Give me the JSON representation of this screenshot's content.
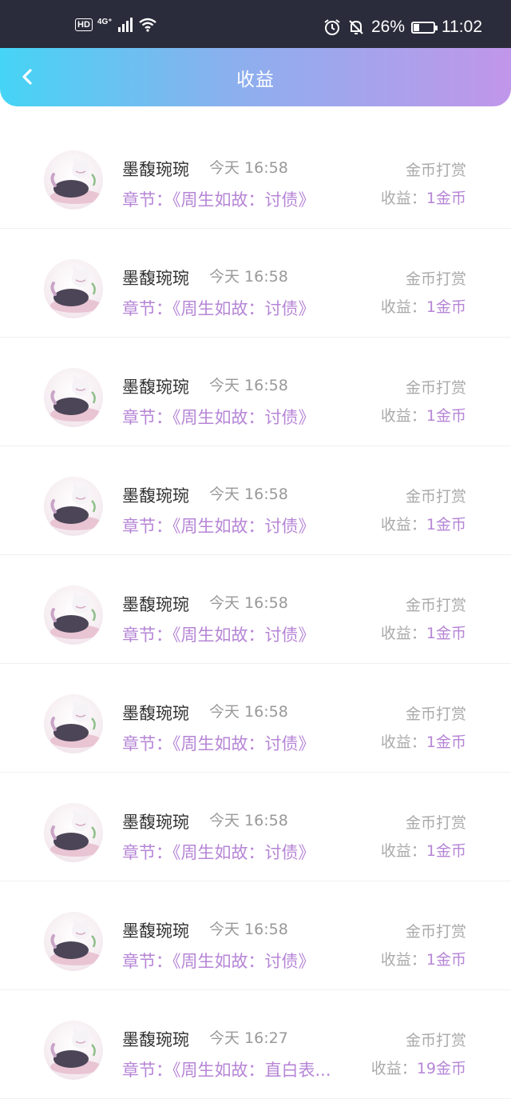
{
  "status_bar": {
    "hd": "HD",
    "network": "4G⁺",
    "battery": "26%",
    "battery_level": 0.26,
    "time": "11:02",
    "icons": [
      "hd-icon",
      "signal-icon",
      "wifi-icon",
      "alarm-icon",
      "mute-icon",
      "battery-icon"
    ]
  },
  "header": {
    "title": "收益",
    "back_icon": "chevron-left-icon",
    "gradient": [
      "#45d4f5",
      "#c196ea"
    ]
  },
  "colors": {
    "accent": "#b685d6",
    "muted": "#aaaaaa",
    "name": "#333333"
  },
  "records": [
    {
      "name": "墨馥琬琬",
      "time": "今天 16:58",
      "type": "金币打赏",
      "chapter_label": "章节：",
      "chapter": "《周生如故：讨债》",
      "earn_label": "收益：",
      "earn_value": "1金币"
    },
    {
      "name": "墨馥琬琬",
      "time": "今天 16:58",
      "type": "金币打赏",
      "chapter_label": "章节：",
      "chapter": "《周生如故：讨债》",
      "earn_label": "收益：",
      "earn_value": "1金币"
    },
    {
      "name": "墨馥琬琬",
      "time": "今天 16:58",
      "type": "金币打赏",
      "chapter_label": "章节：",
      "chapter": "《周生如故：讨债》",
      "earn_label": "收益：",
      "earn_value": "1金币"
    },
    {
      "name": "墨馥琬琬",
      "time": "今天 16:58",
      "type": "金币打赏",
      "chapter_label": "章节：",
      "chapter": "《周生如故：讨债》",
      "earn_label": "收益：",
      "earn_value": "1金币"
    },
    {
      "name": "墨馥琬琬",
      "time": "今天 16:58",
      "type": "金币打赏",
      "chapter_label": "章节：",
      "chapter": "《周生如故：讨债》",
      "earn_label": "收益：",
      "earn_value": "1金币"
    },
    {
      "name": "墨馥琬琬",
      "time": "今天 16:58",
      "type": "金币打赏",
      "chapter_label": "章节：",
      "chapter": "《周生如故：讨债》",
      "earn_label": "收益：",
      "earn_value": "1金币"
    },
    {
      "name": "墨馥琬琬",
      "time": "今天 16:58",
      "type": "金币打赏",
      "chapter_label": "章节：",
      "chapter": "《周生如故：讨债》",
      "earn_label": "收益：",
      "earn_value": "1金币"
    },
    {
      "name": "墨馥琬琬",
      "time": "今天 16:58",
      "type": "金币打赏",
      "chapter_label": "章节：",
      "chapter": "《周生如故：讨债》",
      "earn_label": "收益：",
      "earn_value": "1金币"
    },
    {
      "name": "墨馥琬琬",
      "time": "今天 16:27",
      "type": "金币打赏",
      "chapter_label": "章节：",
      "chapter": "《周生如故：直白表...",
      "earn_label": "收益：",
      "earn_value": "19金币"
    }
  ]
}
